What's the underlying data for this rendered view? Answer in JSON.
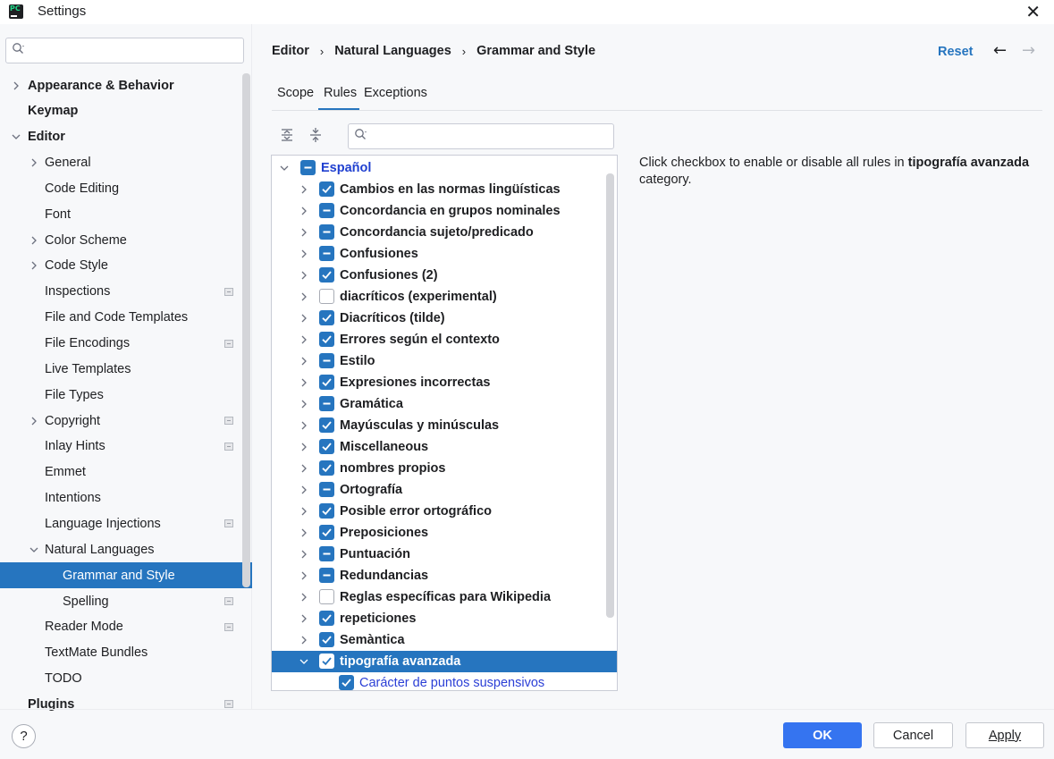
{
  "window": {
    "title": "Settings",
    "app_icon": "pycharm-icon",
    "close_glyph": "✕"
  },
  "sidebar": {
    "search_placeholder": "",
    "items": [
      {
        "label": "Appearance & Behavior",
        "bold": true,
        "chevron": "›",
        "level": 0
      },
      {
        "label": "Keymap",
        "bold": true,
        "chevron": "",
        "level": 0
      },
      {
        "label": "Editor",
        "bold": true,
        "chevron": "⌄",
        "level": 0
      },
      {
        "label": "General",
        "chevron": "›",
        "level": 1
      },
      {
        "label": "Code Editing",
        "chevron": "",
        "level": 1
      },
      {
        "label": "Font",
        "chevron": "",
        "level": 1
      },
      {
        "label": "Color Scheme",
        "chevron": "›",
        "level": 1
      },
      {
        "label": "Code Style",
        "chevron": "›",
        "level": 1
      },
      {
        "label": "Inspections",
        "chevron": "",
        "level": 1,
        "project_icon": true
      },
      {
        "label": "File and Code Templates",
        "chevron": "",
        "level": 1
      },
      {
        "label": "File Encodings",
        "chevron": "",
        "level": 1,
        "project_icon": true
      },
      {
        "label": "Live Templates",
        "chevron": "",
        "level": 1
      },
      {
        "label": "File Types",
        "chevron": "",
        "level": 1
      },
      {
        "label": "Copyright",
        "chevron": "›",
        "level": 1,
        "project_icon": true
      },
      {
        "label": "Inlay Hints",
        "chevron": "",
        "level": 1,
        "project_icon": true
      },
      {
        "label": "Emmet",
        "chevron": "",
        "level": 1
      },
      {
        "label": "Intentions",
        "chevron": "",
        "level": 1
      },
      {
        "label": "Language Injections",
        "chevron": "",
        "level": 1,
        "project_icon": true
      },
      {
        "label": "Natural Languages",
        "chevron": "⌄",
        "level": 1
      },
      {
        "label": "Grammar and Style",
        "chevron": "",
        "level": 2,
        "selected": true
      },
      {
        "label": "Spelling",
        "chevron": "",
        "level": 2,
        "project_icon": true
      },
      {
        "label": "Reader Mode",
        "chevron": "",
        "level": 1,
        "project_icon": true
      },
      {
        "label": "TextMate Bundles",
        "chevron": "",
        "level": 1
      },
      {
        "label": "TODO",
        "chevron": "",
        "level": 1
      },
      {
        "label": "Plugins",
        "bold": true,
        "chevron": "",
        "level": 0,
        "project_icon": true
      }
    ]
  },
  "breadcrumb": {
    "items": [
      "Editor",
      "Natural Languages",
      "Grammar and Style"
    ],
    "separator": "›"
  },
  "header_actions": {
    "reset": "Reset",
    "back_glyph": "←",
    "forward_glyph": "→"
  },
  "tabs": [
    {
      "label": "Scope",
      "active": false
    },
    {
      "label": "Rules",
      "active": true
    },
    {
      "label": "Exceptions",
      "active": false
    }
  ],
  "rules_search_placeholder": "",
  "rules": {
    "root": {
      "label": "Español",
      "state": "partial"
    },
    "categories": [
      {
        "label": "Cambios en las normas lingüísticas",
        "state": "checked"
      },
      {
        "label": "Concordancia en grupos nominales",
        "state": "partial"
      },
      {
        "label": "Concordancia sujeto/predicado",
        "state": "partial"
      },
      {
        "label": "Confusiones",
        "state": "partial"
      },
      {
        "label": "Confusiones (2)",
        "state": "checked"
      },
      {
        "label": "diacríticos (experimental)",
        "state": "unchecked"
      },
      {
        "label": "Diacríticos (tilde)",
        "state": "checked"
      },
      {
        "label": "Errores según el contexto",
        "state": "checked"
      },
      {
        "label": "Estilo",
        "state": "partial"
      },
      {
        "label": "Expresiones incorrectas",
        "state": "checked"
      },
      {
        "label": "Gramática",
        "state": "partial"
      },
      {
        "label": "Mayúsculas y minúsculas",
        "state": "checked"
      },
      {
        "label": "Miscellaneous",
        "state": "checked"
      },
      {
        "label": "nombres propios",
        "state": "checked"
      },
      {
        "label": "Ortografía",
        "state": "partial"
      },
      {
        "label": "Posible error ortográfico",
        "state": "checked"
      },
      {
        "label": "Preposiciones",
        "state": "checked"
      },
      {
        "label": "Puntuación",
        "state": "partial"
      },
      {
        "label": "Redundancias",
        "state": "partial"
      },
      {
        "label": "Reglas específicas para Wikipedia",
        "state": "unchecked"
      },
      {
        "label": "repeticiones",
        "state": "checked"
      },
      {
        "label": "Semàntica",
        "state": "checked"
      },
      {
        "label": "tipografía avanzada",
        "state": "checked",
        "selected": true,
        "expanded": true
      }
    ],
    "children": [
      {
        "label": "Carácter de puntos suspensivos",
        "state": "checked"
      }
    ]
  },
  "description": {
    "prefix": "Click checkbox to enable or disable all rules in ",
    "category": "tipografía avanzada",
    "suffix": "category."
  },
  "footer": {
    "help": "?",
    "ok": "OK",
    "cancel": "Cancel",
    "apply": "Apply"
  },
  "colors": {
    "accent": "#2675bf",
    "primary_button": "#3574f0",
    "root_label": "#2040d0"
  }
}
